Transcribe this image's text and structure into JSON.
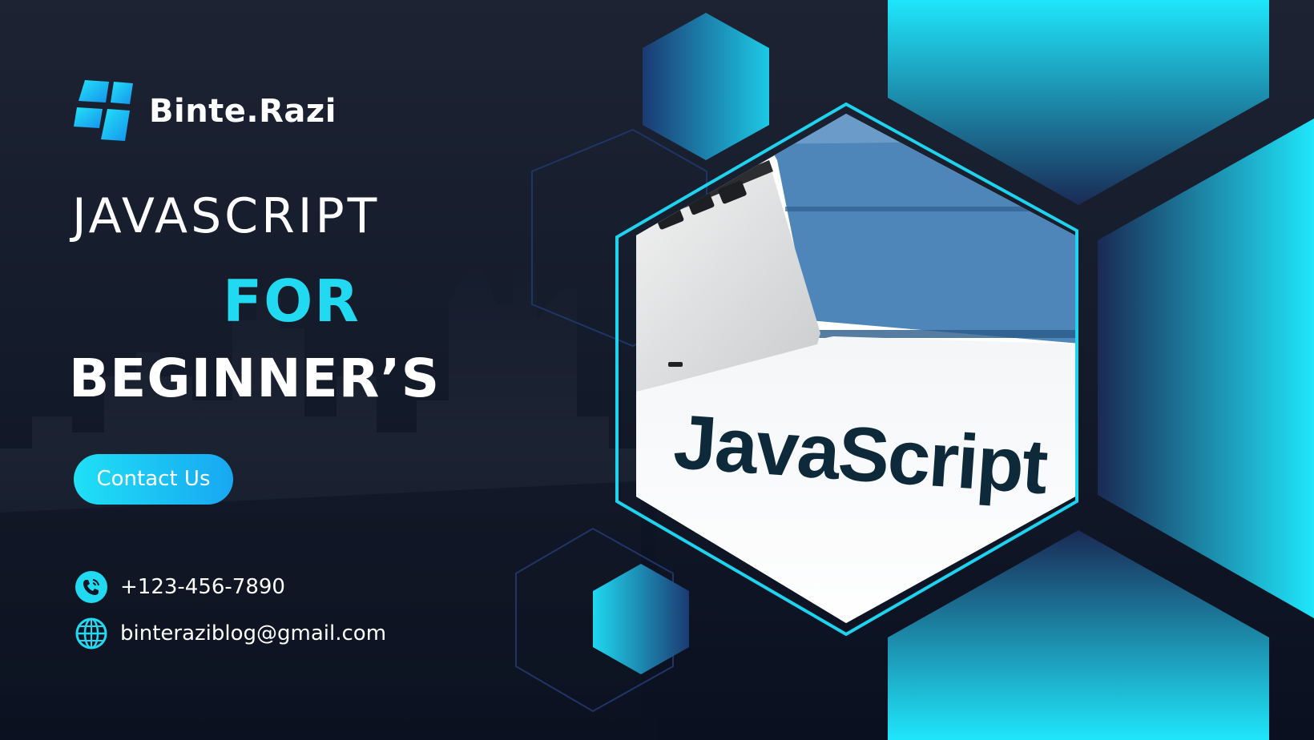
{
  "brand": {
    "name": "Binte.Razi",
    "logo_icon": "window-logo-icon"
  },
  "headline": {
    "line1": "JAVASCRIPT",
    "line2": "FOR",
    "line3": "BEGINNER’S"
  },
  "cta": {
    "label": "Contact Us"
  },
  "contacts": {
    "phone": {
      "icon": "phone-icon",
      "text": "+123-456-7890"
    },
    "email": {
      "icon": "globe-icon",
      "text": "binteraziblog@gmail.com"
    }
  },
  "photo": {
    "caption_text": "JavaScript"
  },
  "colors": {
    "accent": "#22d9f2",
    "button_start": "#1fe0f5",
    "button_end": "#18a7f2",
    "background_dark": "#141b2b",
    "text_primary": "#ffffff"
  }
}
